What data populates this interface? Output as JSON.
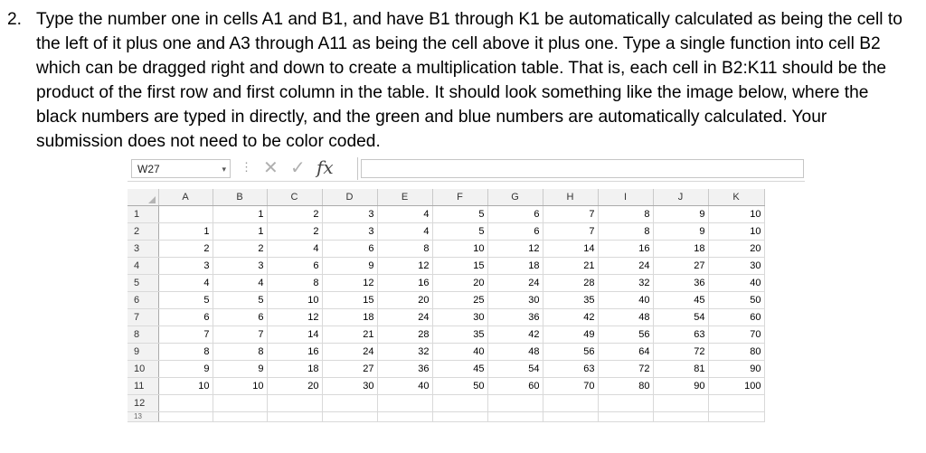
{
  "question": {
    "number": "2.",
    "text": "Type the number one in cells A1 and B1, and have B1 through K1 be automatically calculated as being the cell to the left of it plus one and A3 through A11 as being the cell above it plus one. Type a single function into cell B2 which can be dragged right and down to create a multiplication table. That is, each cell in B2:K11 should be the product of the first row and first column in the table. It should look something like the image below, where the black numbers are typed in directly, and the green and blue numbers are automatically calculated. Your submission does not need to be color coded."
  },
  "formula_bar": {
    "name_box": "W27",
    "name_box_arrow": "▾",
    "separator": "⋮",
    "cancel_icon": "✕",
    "enter_icon": "✓",
    "fx_label": "fx",
    "formula": ""
  },
  "spreadsheet": {
    "columns": [
      "A",
      "B",
      "C",
      "D",
      "E",
      "F",
      "G",
      "H",
      "I",
      "J",
      "K"
    ],
    "rows": [
      {
        "header": "1",
        "cells": [
          "",
          "1",
          "2",
          "3",
          "4",
          "5",
          "6",
          "7",
          "8",
          "9",
          "10"
        ]
      },
      {
        "header": "2",
        "cells": [
          "1",
          "1",
          "2",
          "3",
          "4",
          "5",
          "6",
          "7",
          "8",
          "9",
          "10"
        ]
      },
      {
        "header": "3",
        "cells": [
          "2",
          "2",
          "4",
          "6",
          "8",
          "10",
          "12",
          "14",
          "16",
          "18",
          "20"
        ]
      },
      {
        "header": "4",
        "cells": [
          "3",
          "3",
          "6",
          "9",
          "12",
          "15",
          "18",
          "21",
          "24",
          "27",
          "30"
        ]
      },
      {
        "header": "5",
        "cells": [
          "4",
          "4",
          "8",
          "12",
          "16",
          "20",
          "24",
          "28",
          "32",
          "36",
          "40"
        ]
      },
      {
        "header": "6",
        "cells": [
          "5",
          "5",
          "10",
          "15",
          "20",
          "25",
          "30",
          "35",
          "40",
          "45",
          "50"
        ]
      },
      {
        "header": "7",
        "cells": [
          "6",
          "6",
          "12",
          "18",
          "24",
          "30",
          "36",
          "42",
          "48",
          "54",
          "60"
        ]
      },
      {
        "header": "8",
        "cells": [
          "7",
          "7",
          "14",
          "21",
          "28",
          "35",
          "42",
          "49",
          "56",
          "63",
          "70"
        ]
      },
      {
        "header": "9",
        "cells": [
          "8",
          "8",
          "16",
          "24",
          "32",
          "40",
          "48",
          "56",
          "64",
          "72",
          "80"
        ]
      },
      {
        "header": "10",
        "cells": [
          "9",
          "9",
          "18",
          "27",
          "36",
          "45",
          "54",
          "63",
          "72",
          "81",
          "90"
        ]
      },
      {
        "header": "11",
        "cells": [
          "10",
          "10",
          "20",
          "30",
          "40",
          "50",
          "60",
          "70",
          "80",
          "90",
          "100"
        ]
      },
      {
        "header": "12",
        "cells": [
          "",
          "",
          "",
          "",
          "",
          "",
          "",
          "",
          "",
          "",
          ""
        ]
      },
      {
        "header": "13",
        "cells": [
          "",
          "",
          "",
          "",
          "",
          "",
          "",
          "",
          "",
          "",
          ""
        ]
      }
    ]
  }
}
